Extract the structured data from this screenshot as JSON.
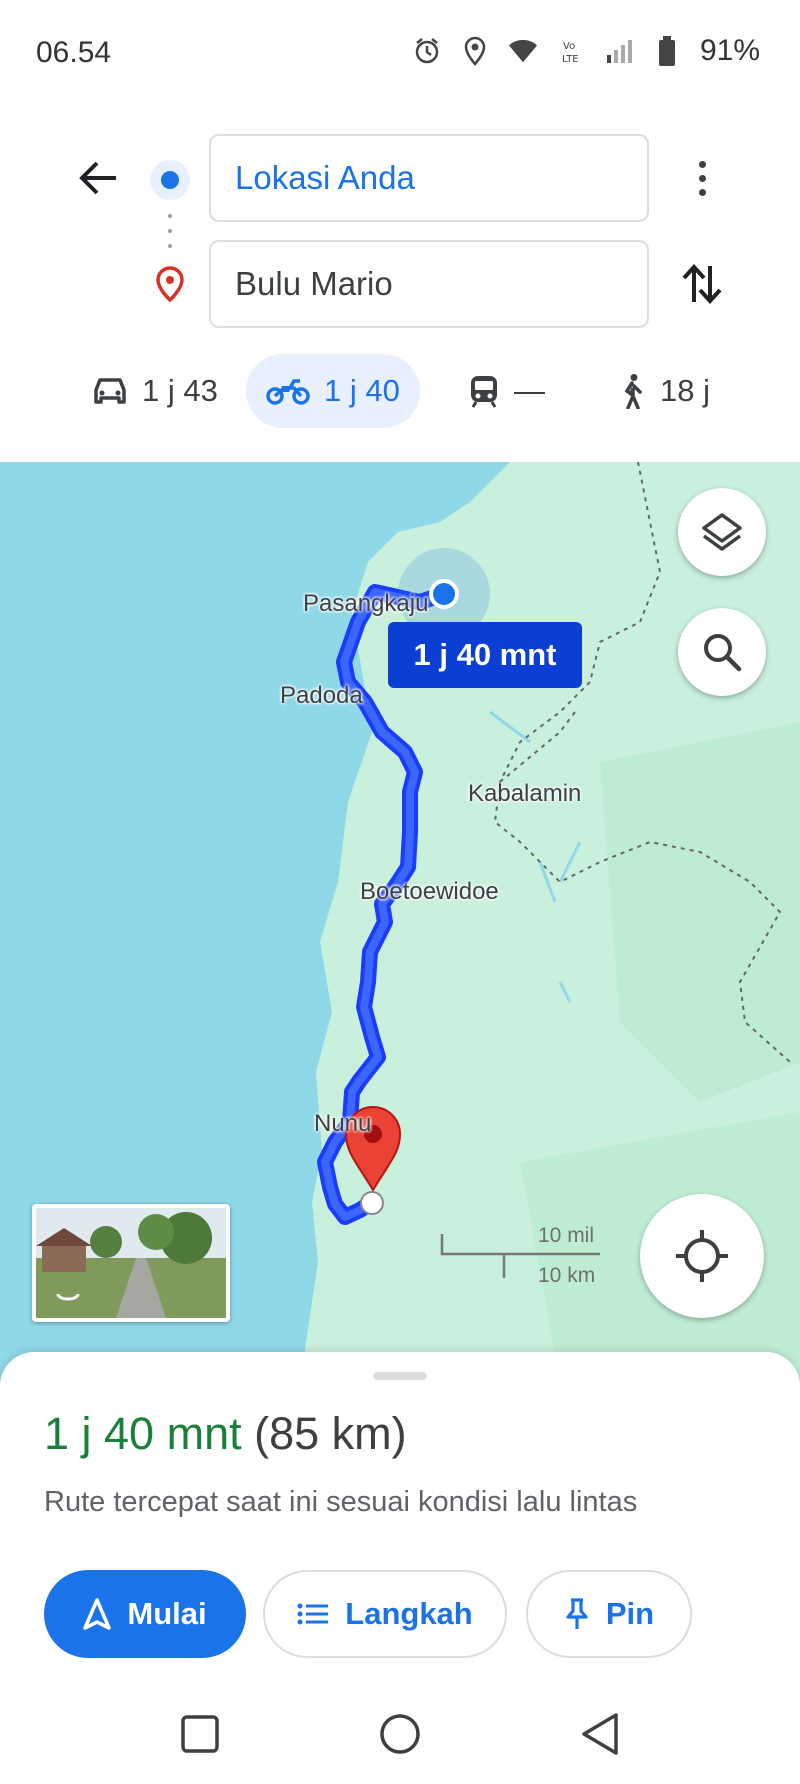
{
  "status_bar": {
    "time": "06.54",
    "battery": "91%",
    "icons": [
      "alarm-icon",
      "location-icon",
      "wifi-icon",
      "volte-icon",
      "signal-icon",
      "battery-icon"
    ]
  },
  "directions": {
    "origin": "Lokasi Anda",
    "destination": "Bulu Mario"
  },
  "modes": [
    {
      "name": "car",
      "icon": "car-icon",
      "label": "1 j 43"
    },
    {
      "name": "motorcycle",
      "icon": "motorcycle-icon",
      "label": "1 j 40",
      "selected": true
    },
    {
      "name": "transit",
      "icon": "transit-icon",
      "label": "—"
    },
    {
      "name": "walk",
      "icon": "walk-icon",
      "label": "18 j"
    }
  ],
  "map": {
    "eta_chip": "1 j 40 mnt",
    "places": [
      "Pasangkaju",
      "Padoda",
      "Kabalamin",
      "Boetoewidoe",
      "Nunu"
    ],
    "scale": {
      "miles": "10 mil",
      "km": "10 km"
    },
    "colors": {
      "water": "#8fd8e8",
      "land": "#c9f0dd",
      "route": "#1a3cff"
    }
  },
  "sheet": {
    "duration": "1 j 40 mnt",
    "distance": "(85 km)",
    "subtitle": "Rute tercepat saat ini sesuai kondisi lalu lintas",
    "buttons": {
      "start": "Mulai",
      "steps": "Langkah",
      "pin": "Pin"
    }
  },
  "colors": {
    "accent": "#1a73e8",
    "duration_green": "#188038"
  }
}
